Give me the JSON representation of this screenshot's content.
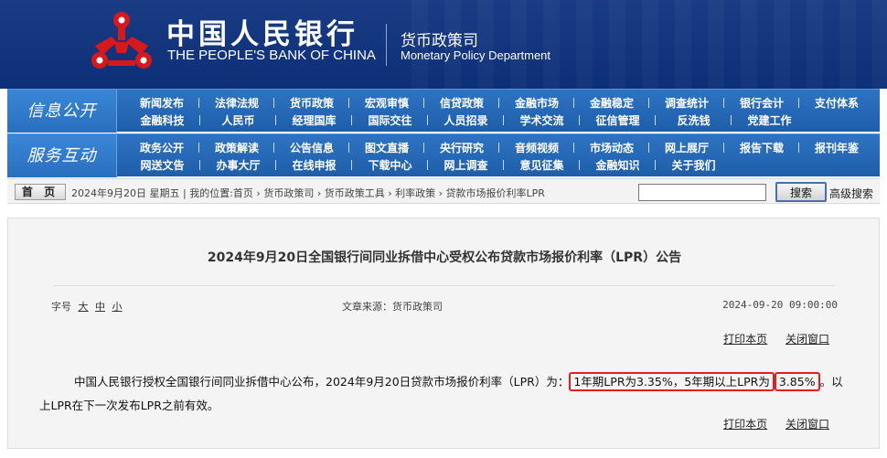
{
  "header": {
    "bank_cn": "中国人民银行",
    "bank_en": "THE PEOPLE'S BANK OF CHINA",
    "dept_cn": "货币政策司",
    "dept_en": "Monetary Policy Department",
    "logo_icon": "pboc-logo-icon",
    "brand_red": "#d7191b",
    "brand_blue": "#12357f"
  },
  "nav_info": {
    "title": "信息公开",
    "row1": [
      "新闻发布",
      "法律法规",
      "货币政策",
      "宏观审慎",
      "信贷政策",
      "金融市场",
      "金融稳定",
      "调查统计",
      "银行会计",
      "支付体系"
    ],
    "row2": [
      "金融科技",
      "人民币",
      "经理国库",
      "国际交往",
      "人员招录",
      "学术交流",
      "征信管理",
      "反洗钱",
      "党建工作"
    ]
  },
  "nav_service": {
    "title": "服务互动",
    "row1": [
      "政务公开",
      "政策解读",
      "公告信息",
      "图文直播",
      "央行研究",
      "音频视频",
      "市场动态",
      "网上展厅",
      "报告下载",
      "报刊年鉴"
    ],
    "row2": [
      "网送文告",
      "办事大厅",
      "在线申报",
      "下载中心",
      "网上调查",
      "意见征集",
      "金融知识",
      "关于我们"
    ]
  },
  "crumbbar": {
    "home_label": "首 页",
    "date_text": "2024年9月20日 星期五",
    "location_label": "我的位置:",
    "path": [
      "首页",
      "货币政策司",
      "货币政策工具",
      "利率政策",
      "贷款市场报价利率LPR"
    ],
    "search_placeholder": "",
    "search_label": "搜索",
    "advanced_label": "高级搜索"
  },
  "article": {
    "title": "2024年9月20日全国银行间同业拆借中心受权公布贷款市场报价利率（LPR）公告",
    "font_label": "字号",
    "font_sizes": [
      "大",
      "中",
      "小"
    ],
    "source": "文章来源：货币政策司",
    "date": "2024-09-20 09:00:00",
    "print_label": "打印本页",
    "close_label": "关闭窗口",
    "body_prefix": "中国人民银行授权全国银行间同业拆借中心公布，2024年9月20日贷款市场报价利率（LPR）为：",
    "body_highlight_1": "1年期LPR为3.35%，5年期以上LPR为",
    "body_highlight_2": "3.85%",
    "body_suffix": "。以上LPR在下一次发布LPR之前有效。",
    "highlight_color": "#e02020"
  }
}
